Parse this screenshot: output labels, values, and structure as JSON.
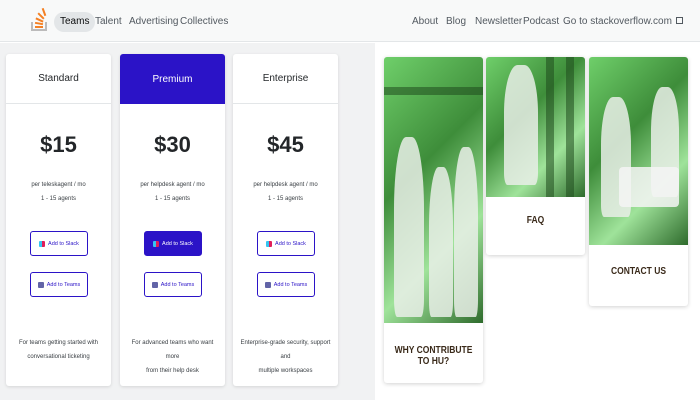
{
  "nav": {
    "links": [
      "Teams",
      "Talent",
      "Advertising",
      "Collectives"
    ],
    "right_links": [
      "About",
      "Blog",
      "Newsletter",
      "Podcast",
      "Go to stackoverflow.com"
    ],
    "logo_icon": "stack-overflow-logo-icon",
    "external_icon": "external-link-icon"
  },
  "pricing": {
    "cards": [
      {
        "name": "Standard",
        "price": "$15",
        "desc_line1": "per teleskagent / mo",
        "desc_line2": "1 - 15 agents",
        "slack_label": "Add to Slack",
        "teams_label": "Add to Teams",
        "footer_line1": "For teams getting started with",
        "footer_line2": "conversational ticketing"
      },
      {
        "name": "Premium",
        "price": "$30",
        "desc_line1": "per helpdesk agent / mo",
        "desc_line2": "1 - 15 agents",
        "slack_label": "Add to Slack",
        "teams_label": "Add to Teams",
        "footer_line1": "For advanced teams who want more",
        "footer_line2": "from their help desk"
      },
      {
        "name": "Enterprise",
        "price": "$45",
        "desc_line1": "per helpdesk agent / mo",
        "desc_line2": "1 - 15 agents",
        "slack_label": "Add to Slack",
        "teams_label": "Add to Teams",
        "footer_line1": "Enterprise-grade security, support and",
        "footer_line2": "multiple workspaces"
      }
    ]
  },
  "tiles": [
    {
      "label": "WHY CONTRIBUTE TO HU?"
    },
    {
      "label": "FAQ"
    },
    {
      "label": "CONTACT US"
    }
  ],
  "colors": {
    "accent": "#2b13c7",
    "tile_image_tint": "#6fcf6a"
  }
}
